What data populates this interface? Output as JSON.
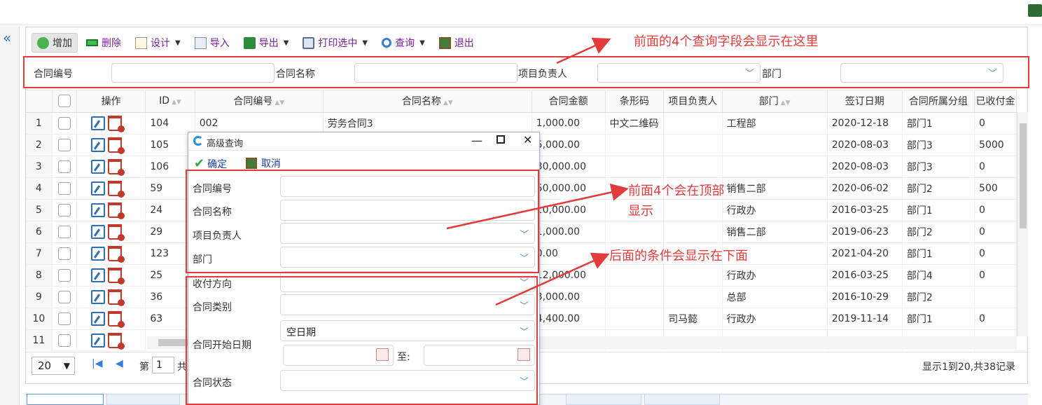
{
  "toolbar": {
    "buttons": [
      {
        "label": "增加",
        "icon": "plus-circle-icon",
        "color": "#4caf50"
      },
      {
        "label": "删除",
        "icon": "minus-bar-icon",
        "color": "#2e9d3b"
      },
      {
        "label": "设计",
        "icon": "design-edit-icon",
        "color": "#e0a030",
        "caret": "▼"
      },
      {
        "label": "导入",
        "icon": "import-icon",
        "color": "#6a8fbf"
      },
      {
        "label": "导出",
        "icon": "excel-export-icon",
        "color": "#2e8b3a",
        "caret": "▼"
      },
      {
        "label": "打印选中",
        "icon": "printer-icon",
        "color": "#6a7fa0",
        "caret": "▼"
      },
      {
        "label": "查询",
        "icon": "magnifier-icon",
        "color": "#3a7bd5",
        "caret": "▼"
      },
      {
        "label": "退出",
        "icon": "exit-door-icon",
        "color": "#2e7d32"
      }
    ]
  },
  "query_bar": {
    "contract_no_label": "合同编号",
    "contract_name_label": "合同名称",
    "manager_label": "项目负责人",
    "dept_label": "部门"
  },
  "grid": {
    "headers": [
      "操作",
      "ID",
      "合同编号",
      "合同名称",
      "合同金额",
      "条形码",
      "项目负责人",
      "部门",
      "签订日期",
      "合同所属分组",
      "已收付金"
    ],
    "rows": [
      {
        "n": "1",
        "id": "104",
        "no": "002",
        "name": "劳务合同3",
        "amount": "1,000.00",
        "barcode": "中文二维码",
        "mgr": "",
        "dept": "工程部",
        "date": "2020-12-18",
        "group": "部门1",
        "paid": "0"
      },
      {
        "n": "2",
        "id": "105",
        "no": "",
        "name": "",
        "amount": "5,000.00",
        "barcode": "",
        "mgr": "",
        "dept": "",
        "date": "2020-08-03",
        "group": "部门3",
        "paid": "5000"
      },
      {
        "n": "3",
        "id": "106",
        "no": "",
        "name": "",
        "amount": "30,000.00",
        "barcode": "",
        "mgr": "",
        "dept": "",
        "date": "2020-08-03",
        "group": "部门3",
        "paid": "0"
      },
      {
        "n": "4",
        "id": "59",
        "no": "",
        "name": "",
        "amount": "50,000.00",
        "barcode": "",
        "mgr": "",
        "dept": "销售二部",
        "date": "2020-06-02",
        "group": "部门2",
        "paid": "500"
      },
      {
        "n": "5",
        "id": "24",
        "no": "",
        "name": "",
        "amount": "10,000.00",
        "barcode": "",
        "mgr": "",
        "dept": "行政办",
        "date": "2016-03-25",
        "group": "部门1",
        "paid": "0"
      },
      {
        "n": "6",
        "id": "29",
        "no": "",
        "name": "",
        "amount": "1,000.00",
        "barcode": "",
        "mgr": "",
        "dept": "销售二部",
        "date": "2019-06-23",
        "group": "部门2",
        "paid": "0"
      },
      {
        "n": "7",
        "id": "123",
        "no": "",
        "name": "",
        "amount": "0.00",
        "barcode": "",
        "mgr": "",
        "dept": "",
        "date": "2021-04-20",
        "group": "部门1",
        "paid": "0"
      },
      {
        "n": "8",
        "id": "25",
        "no": "",
        "name": "",
        "amount": "12,000.00",
        "barcode": "",
        "mgr": "",
        "dept": "行政办",
        "date": "2016-03-25",
        "group": "部门4",
        "paid": "0"
      },
      {
        "n": "9",
        "id": "36",
        "no": "",
        "name": "",
        "amount": "3,000.00",
        "barcode": "",
        "mgr": "",
        "dept": "总部",
        "date": "2016-10-29",
        "group": "部门2",
        "paid": ""
      },
      {
        "n": "10",
        "id": "63",
        "no": "",
        "name": "",
        "amount": "4,400.00",
        "barcode": "",
        "mgr": "司马懿",
        "dept": "行政办",
        "date": "2019-11-14",
        "group": "部门1",
        "paid": "0"
      },
      {
        "n": "11",
        "id": "",
        "no": "",
        "name": "",
        "amount": "",
        "barcode": "",
        "mgr": "",
        "dept": "",
        "date": "",
        "group": "",
        "paid": ""
      }
    ]
  },
  "pager": {
    "page_size": "20",
    "page_prefix": "第",
    "page_value": "1",
    "page_suffix": "共",
    "summary": "显示1到20,共38记录"
  },
  "dialog": {
    "title": "高级查询",
    "ok_label": "确定",
    "cancel_label": "取消",
    "f_no": "合同编号",
    "f_name": "合同名称",
    "f_mgr": "项目负责人",
    "f_dept": "部门",
    "f_dir": "收付方向",
    "f_type": "合同类别",
    "f_start": "合同开始日期",
    "start_mode": "空日期",
    "to_label": "至:",
    "f_status": "合同状态"
  },
  "annotations": {
    "top": "前面的4个查询字段会显示在这里",
    "middle_1": "前面4个会在顶部",
    "middle_2": "显示",
    "bottom": "后面的条件会显示在下面",
    "color": "#e23b3b"
  }
}
